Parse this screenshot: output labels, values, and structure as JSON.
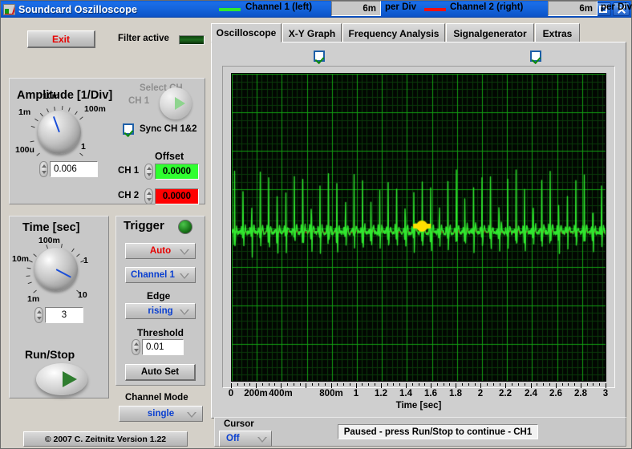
{
  "window": {
    "title": "Soundcard Oszilloscope",
    "minimize_label": "Minimize",
    "maximize_label": "Maximize",
    "close_label": "Close"
  },
  "toolbar": {
    "exit_label": "Exit",
    "filter_label": "Filter active",
    "filter_state": "on"
  },
  "tabs": [
    {
      "label": "Oscilloscope",
      "active": true
    },
    {
      "label": "X-Y Graph",
      "active": false
    },
    {
      "label": "Frequency Analysis",
      "active": false
    },
    {
      "label": "Signalgenerator",
      "active": false
    },
    {
      "label": "Extras",
      "active": false
    }
  ],
  "channels": [
    {
      "label": "Channel 1 (left)",
      "color": "#2fe82f",
      "enabled": true,
      "per_div_value": "6m",
      "per_div_label": "per Div"
    },
    {
      "label": "Channel 2 (right)",
      "color": "#f01010",
      "enabled": true,
      "per_div_value": "6m",
      "per_div_label": "per Div"
    }
  ],
  "amplitude": {
    "title": "Amplitude [1/Div]",
    "knob_labels": [
      "1m",
      "10m",
      "100m",
      "1",
      "100u"
    ],
    "value": "0.006"
  },
  "select_ch": {
    "title": "Select CH",
    "current": "CH 1",
    "sync_label": "Sync CH 1&2",
    "sync_checked": true
  },
  "offset": {
    "title": "Offset",
    "rows": [
      {
        "label": "CH 1",
        "value": "0.0000",
        "color": "#2fff2f"
      },
      {
        "label": "CH 2",
        "value": "0.0000",
        "color": "#ff0000"
      }
    ]
  },
  "time": {
    "title": "Time [sec]",
    "knob_labels": [
      "10m",
      "100m",
      "1",
      "10",
      "1m"
    ],
    "value": "3"
  },
  "trigger": {
    "title": "Trigger",
    "led_state": "on",
    "mode": "Auto",
    "mode_color": "#e60000",
    "source": "Channel 1",
    "source_color": "#0a3fd0",
    "edge_label": "Edge",
    "edge": "rising",
    "edge_color": "#0a3fd0",
    "threshold_label": "Threshold",
    "threshold": "0.01",
    "autoset_label": "Auto Set"
  },
  "run_stop": {
    "label": "Run/Stop"
  },
  "channel_mode": {
    "label": "Channel Mode",
    "value": "single",
    "value_color": "#0a3fd0"
  },
  "cursor": {
    "label": "Cursor",
    "value": "Off",
    "value_color": "#0a3fd0"
  },
  "status": {
    "message": "Paused - press Run/Stop to continue - CH1"
  },
  "footer": {
    "copyright": "© 2007   C. Zeitnitz Version 1.22"
  },
  "chart_data": {
    "type": "line",
    "title": "",
    "xlabel": "Time [sec]",
    "ylabel": "",
    "xlim": [
      0,
      3
    ],
    "ylim": [
      -0.024,
      0.024
    ],
    "grid": true,
    "x_major_ticks": [
      0,
      0.2,
      0.4,
      0.6,
      0.8,
      1.0,
      1.2,
      1.4,
      1.6,
      1.8,
      2.0,
      2.2,
      2.4,
      2.6,
      2.8,
      3.0
    ],
    "x_tick_labels": [
      "0",
      "200m",
      "400m",
      "",
      "800m",
      "1",
      "1.2",
      "1.4",
      "1.6",
      "1.8",
      "2",
      "2.2",
      "2.4",
      "2.6",
      "2.8",
      "3"
    ],
    "y_divisions": 8,
    "minor_per_division": 5,
    "background": "#020702",
    "grid_color": "#12a012",
    "minor_grid_color": "#0a3a0a",
    "series": [
      {
        "name": "Channel 1 (left)",
        "color": "#2fe82f",
        "description": "ECG-like periodic signal, ~44 sharp positive spikes over 3 s, baseline near 0"
      },
      {
        "name": "Channel 2 (right)",
        "color": "#b03010",
        "description": "Low-amplitude residual near baseline"
      }
    ],
    "cursor_marker": {
      "color": "#ffe000",
      "x": 1.52,
      "y": 0.002
    },
    "baseline_fraction": 0.5,
    "spike_count": 44
  }
}
